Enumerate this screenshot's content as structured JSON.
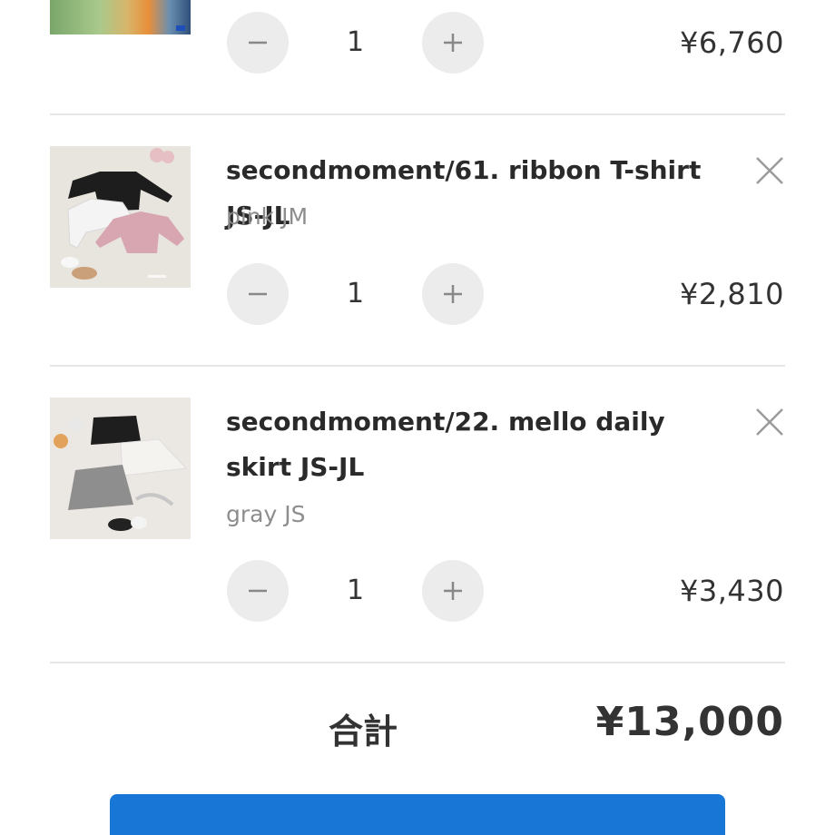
{
  "cart": {
    "items": [
      {
        "name": "",
        "variant": "",
        "quantity": "1",
        "price": "¥6,760"
      },
      {
        "name": "secondmoment/61. ribbon T-shirt JS-JL",
        "variant": "pink JM",
        "quantity": "1",
        "price": "¥2,810"
      },
      {
        "name": "secondmoment/22. mello daily skirt JS-JL",
        "variant": "gray JS",
        "quantity": "1",
        "price": "¥3,430"
      }
    ],
    "total_label": "合計",
    "total_value": "¥13,000"
  },
  "icons": {
    "minus": "minus-icon",
    "plus": "plus-icon",
    "remove": "close-icon"
  },
  "colors": {
    "accent": "#1877d6",
    "qty_button_bg": "#ececec",
    "variant_text": "#8d8d8d",
    "divider": "#e6e6e6"
  }
}
